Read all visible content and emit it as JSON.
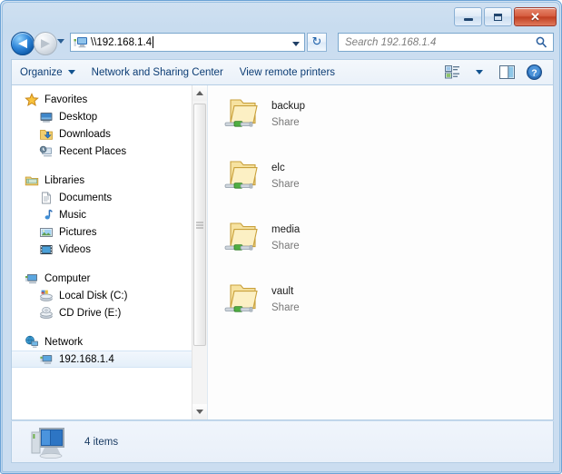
{
  "window": {
    "minimize_label": "Minimize",
    "maximize_label": "Maximize",
    "close_label": "Close",
    "close_glyph": "✕"
  },
  "address_bar": {
    "back_label": "Back",
    "forward_label": "Forward",
    "back_glyph": "◀",
    "forward_glyph": "▶",
    "path": "\\\\192.168.1.4",
    "refresh_glyph": "↻",
    "history_label": "Recent pages"
  },
  "search": {
    "placeholder": "Search 192.168.1.4"
  },
  "toolbar": {
    "organize_label": "Organize",
    "network_sharing_label": "Network and Sharing Center",
    "view_printers_label": "View remote printers",
    "change_view_label": "Change your view",
    "preview_pane_label": "Show the preview pane",
    "help_label": "Get help",
    "help_glyph": "?"
  },
  "sidebar": {
    "groups": [
      {
        "header": {
          "label": "Favorites",
          "icon": "star-icon"
        },
        "items": [
          {
            "label": "Desktop",
            "icon": "desktop-icon"
          },
          {
            "label": "Downloads",
            "icon": "downloads-icon"
          },
          {
            "label": "Recent Places",
            "icon": "recent-places-icon"
          }
        ]
      },
      {
        "header": {
          "label": "Libraries",
          "icon": "libraries-icon"
        },
        "items": [
          {
            "label": "Documents",
            "icon": "documents-icon"
          },
          {
            "label": "Music",
            "icon": "music-icon"
          },
          {
            "label": "Pictures",
            "icon": "pictures-icon"
          },
          {
            "label": "Videos",
            "icon": "videos-icon"
          }
        ]
      },
      {
        "header": {
          "label": "Computer",
          "icon": "computer-icon"
        },
        "items": [
          {
            "label": "Local Disk (C:)",
            "icon": "hard-disk-icon"
          },
          {
            "label": "CD Drive (E:)",
            "icon": "cd-drive-icon"
          }
        ]
      },
      {
        "header": {
          "label": "Network",
          "icon": "network-globe-icon"
        },
        "items": [
          {
            "label": "192.168.1.4",
            "icon": "network-computer-icon",
            "selected": true
          }
        ]
      }
    ]
  },
  "files": {
    "items": [
      {
        "name": "backup",
        "type": "Share"
      },
      {
        "name": "elc",
        "type": "Share"
      },
      {
        "name": "media",
        "type": "Share"
      },
      {
        "name": "vault",
        "type": "Share"
      }
    ]
  },
  "statusbar": {
    "item_count": "4 items",
    "icon": "computer-icon"
  },
  "colors": {
    "frame": "#c8dcef",
    "accent": "#0b3c74",
    "close_button": "#c13f22",
    "folder": "#f4dd8e",
    "selection": "#e4eff9"
  }
}
